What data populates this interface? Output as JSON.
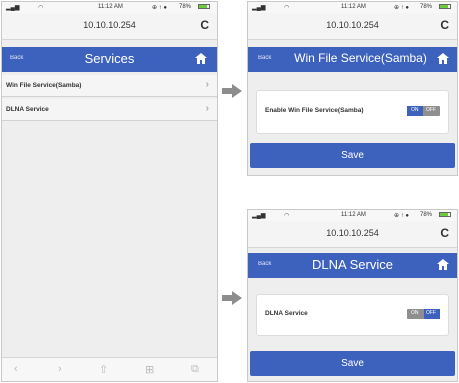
{
  "status": {
    "carrier": "atl",
    "time": "11:12 AM",
    "battery_pct": "78%"
  },
  "browser": {
    "url": "10.10.10.254",
    "reload_icon": "reload-icon"
  },
  "services_screen": {
    "back": "Back",
    "title": "Services",
    "items": [
      {
        "label": "Win File Service(Samba)"
      },
      {
        "label": "DLNA Service"
      }
    ],
    "toolbar": [
      "back-icon",
      "forward-icon",
      "share-icon",
      "bookmarks-icon",
      "tabs-icon"
    ]
  },
  "samba_screen": {
    "back": "Back",
    "title": "Win File Service(Samba)",
    "setting_label": "Enable Win File Service(Samba)",
    "toggle": {
      "on": "ON",
      "off": "OFF",
      "state": "on"
    },
    "save": "Save"
  },
  "dlna_screen": {
    "back": "Back",
    "title": "DLNA Service",
    "setting_label": "DLNA Service",
    "toggle": {
      "on": "ON",
      "off": "OFF",
      "state": "off"
    },
    "save": "Save"
  },
  "colors": {
    "accent": "#3d62bd",
    "arrow": "#8d8d8d",
    "background": "#eeeeee"
  }
}
